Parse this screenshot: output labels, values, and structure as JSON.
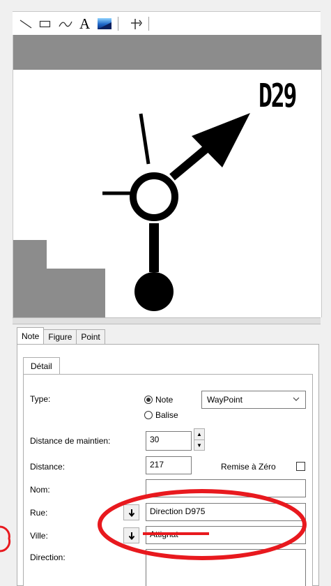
{
  "toolbar": {
    "tools": [
      {
        "icon": "line-tool-icon"
      },
      {
        "icon": "rectangle-tool-icon"
      },
      {
        "icon": "curve-tool-icon"
      },
      {
        "icon": "text-tool-icon",
        "glyph": "A"
      },
      {
        "icon": "color-fill-icon"
      },
      {
        "icon": "junction-tool-icon"
      }
    ]
  },
  "canvas": {
    "road_label": "D29",
    "accent_color": "#e8191e"
  },
  "tabs": {
    "outer": [
      "Note",
      "Figure",
      "Point"
    ],
    "active_outer": "Note",
    "inner": [
      "Détail"
    ]
  },
  "form": {
    "type_label": "Type:",
    "type_options": [
      "Note",
      "Balise"
    ],
    "type_selected": "Note",
    "type_dropdown_value": "WayPoint",
    "distance_maintien_label": "Distance de maintien:",
    "distance_maintien_value": "30",
    "distance_label": "Distance:",
    "distance_value": "217",
    "remise_label": "Remise à Zéro",
    "nom_label": "Nom:",
    "nom_value": "",
    "rue_label": "Rue:",
    "rue_value": "Direction D975",
    "ville_label": "Ville:",
    "ville_value": "Attignat",
    "direction_label": "Direction:",
    "direction_value": ""
  }
}
